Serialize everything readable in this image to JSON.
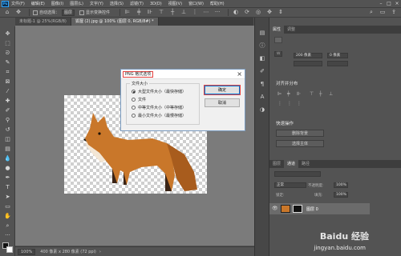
{
  "menubar": {
    "items": [
      "文件(F)",
      "编辑(E)",
      "图像(I)",
      "图层(L)",
      "文字(Y)",
      "选择(S)",
      "滤镜(T)",
      "3D(D)",
      "视图(V)",
      "窗口(W)",
      "帮助(H)"
    ]
  },
  "options_bar": {
    "auto_select_label": "自动选择：",
    "auto_select_value": "图层",
    "transform_controls_label": "显示变换控件"
  },
  "doc_tabs": [
    {
      "label": "未标题-1 @ 25%(RGB/8)"
    },
    {
      "label": "狐狸 (2).jpg @ 100% (图层 0, RGB/8#) *"
    }
  ],
  "statusbar": {
    "zoom": "100%",
    "info": "400 像素 x 280 像素 (72 ppi)"
  },
  "right_panel": {
    "tabs": [
      "属性",
      "调整"
    ],
    "width_value": "200 像素",
    "height_value": "0 像素",
    "align_title": "对齐并分布",
    "quick_actions_title": "快速操作",
    "remove_bg_button": "删除背景",
    "select_subject_button": "选择主体",
    "layers_tabs": [
      "图层",
      "通道",
      "路径"
    ],
    "blend_mode": "正常",
    "opacity_label": "不透明度:",
    "opacity_value": "100%",
    "fill_label": "填充:",
    "fill_value": "100%",
    "lock_label": "锁定:",
    "layer_name": "图层 0"
  },
  "dialog": {
    "title": "PNG 格式选项",
    "close_glyph": "×",
    "group_label": "文件大小",
    "options": [
      {
        "label": "大型文件大小（最快存储）",
        "selected": true
      },
      {
        "label": "文件",
        "selected": false
      },
      {
        "label": "中等文件大小（中等存储）",
        "selected": false
      },
      {
        "label": "最小文件大小（最慢存储）",
        "selected": false
      }
    ],
    "ok_label": "确定",
    "cancel_label": "取消"
  },
  "watermark": {
    "text": "Baidu 经验",
    "url": "jingyan.baidu.com"
  }
}
